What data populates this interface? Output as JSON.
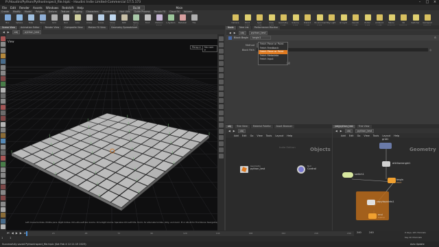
{
  "window": {
    "title": "P:/Houdini/Python/PythonInspect_file.hiplc - Houdini Indie Limited-Commercial 17.5.173"
  },
  "menu": [
    "File",
    "Edit",
    "Render",
    "Assets",
    "Windows",
    "Redshift",
    "Help"
  ],
  "build_label": "Build",
  "main_label": "Main",
  "shelf_tabs": [
    "Create",
    "Modify",
    "Model",
    "Polygon",
    "Deform",
    "Texture",
    "Rigging",
    "Characters",
    "Constraints",
    "Hair Utils",
    "Guide Process",
    "Terrain FX",
    "Cloud FX",
    "Volume",
    "Lights and Cameras",
    "Collisions",
    "Particles",
    "Grains",
    "Vellum",
    "Rigid Bodies",
    "Particle Fluids",
    "Viscous Fluids",
    "Oceans",
    "Fluid Containers",
    "Populate Containers",
    "Container Tools",
    "Pyro FX",
    "FEM",
    "Wires",
    "Crowds",
    "Drive Simulation"
  ],
  "left_tools": [
    "Box",
    "Sphere",
    "Tube",
    "Torus",
    "Grid",
    "Null",
    "Line",
    "Circle",
    "Curve",
    "Draw Curve",
    "Path",
    "Spray Paint",
    "Font",
    "Platonic Solids",
    "L-System",
    "Metaball",
    "File"
  ],
  "right_tools": [
    "Camera",
    "Point Light",
    "Spot Light",
    "Area Light",
    "Geometry Light",
    "Volume Light",
    "Distant Light",
    "Environment Light",
    "Sky Light",
    "GI Light",
    "Caustic Light",
    "Portal Light",
    "Ambient Light",
    "Stereo Camera",
    "VR Camera",
    "Switcher",
    "Gamepad Camera"
  ],
  "left_pane_tabs": [
    "Scene View",
    "Animation Editor",
    "Render View",
    "Composite View",
    "Motion FX View",
    "Geometry Spreadsheet"
  ],
  "left_path": {
    "node": "obj",
    "object": "python_test"
  },
  "view_label": "View",
  "persp_label": "Persp ▾",
  "cam_label": "No cam ▾",
  "viewport_hint": "Left mouse tumbles. Middle pans. Right dollies. Ctrl+Alt+Left box zooms. Ctrl+Right zooms. Spacebar-Ctrl-Left tilts. Hold L for alternate tumble, dolly, and zoom. M or Alt+M for First Person Navigation.",
  "param_tabs": [
    "Node",
    "Take List",
    "Performance Monitor"
  ],
  "param_path": {
    "node": "obj",
    "object": "python_test"
  },
  "param_header": {
    "type": "Block Begin",
    "name": "begin1"
  },
  "param_fields": [
    {
      "label": "Method",
      "value": "Fetch Piece or Point"
    },
    {
      "label": "Block Path",
      "value": ""
    }
  ],
  "dropdown_options": [
    "Fetch Piece or Point",
    "Fetch Feedback",
    "Fetch Piece or Point",
    "Fetch Metadata",
    "Fetch Input"
  ],
  "dropdown_highlight_index": 2,
  "dropdown_tooltip": "...",
  "net_left_tabs": [
    "obj",
    "Tree View",
    "Material Palette",
    "Asset Browser"
  ],
  "net_left_path": "obj",
  "net_menu": [
    "Add",
    "Edit",
    "Go",
    "View",
    "Tools",
    "Layout",
    "Help"
  ],
  "net_left_watermark_small": "Indie Edition",
  "net_left_watermark": "Objects",
  "obj_nodes": [
    {
      "type": "Geometry",
      "name": "python_test"
    },
    {
      "type": "Null",
      "name": "Control"
    }
  ],
  "net_right_tabs": [
    "/obj/python_test",
    "Tree View"
  ],
  "net_right_path": {
    "node": "obj",
    "object": "python_test"
  },
  "net_right_watermark": "Geometry",
  "sop_nodes": [
    {
      "name": "grid1"
    },
    {
      "name": "attribwrangle1"
    },
    {
      "name": "switch1"
    },
    {
      "name": "begin",
      "sub": "Point"
    },
    {
      "name": "copytopoints1"
    },
    {
      "name": "end",
      "sub": "Gather"
    }
  ],
  "timeline": {
    "start": "1",
    "end": "240",
    "current": "1",
    "end_field": "240",
    "end_field2": "240",
    "ticks": [
      "24",
      "48",
      "72",
      "96",
      "120",
      "144",
      "168",
      "192",
      "216",
      "240"
    ]
  },
  "keys_label": "0 keys, 0/0 channels",
  "key_all_label": "Key All Channels",
  "auto_update": "Auto Update",
  "status": "Successfully saved PythonInspect_file.hiplc (Sat Feb 4 12:11:15 2023)",
  "colors": {
    "accent": "#e07a1f",
    "selected_node": "#f0a030",
    "viewport_bg": "#0f0f10",
    "grid_plane": "#b8b8b8"
  }
}
